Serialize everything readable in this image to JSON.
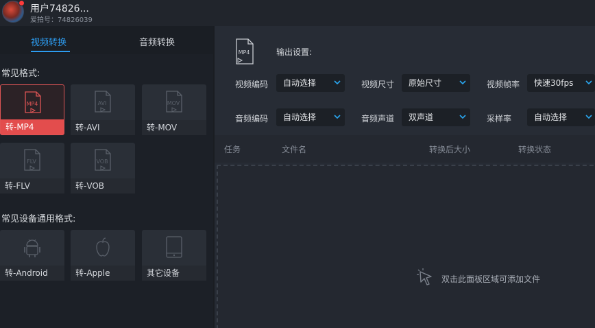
{
  "user": {
    "name": "用户74826...",
    "id_text": "爱拍号：74826039"
  },
  "tabs": {
    "video": "视频转换",
    "audio": "音频转换"
  },
  "sections": {
    "common_formats": "常见格式:",
    "device_formats": "常见设备通用格式:"
  },
  "formats": [
    {
      "icon_text": "MP4",
      "label": "转-MP4",
      "selected": true
    },
    {
      "icon_text": "AVI",
      "label": "转-AVI",
      "selected": false
    },
    {
      "icon_text": "MOV",
      "label": "转-MOV",
      "selected": false
    },
    {
      "icon_text": "FLV",
      "label": "转-FLV",
      "selected": false
    },
    {
      "icon_text": "VOB",
      "label": "转-VOB",
      "selected": false
    }
  ],
  "devices": [
    {
      "icon": "android-icon",
      "label": "转-Android"
    },
    {
      "icon": "apple-icon",
      "label": "转-Apple"
    },
    {
      "icon": "tablet-icon",
      "label": "其它设备"
    }
  ],
  "output": {
    "icon_text": "MP4",
    "label": "输出设置:",
    "video_codec_label": "视频编码",
    "video_codec_value": "自动选择",
    "video_size_label": "视频尺寸",
    "video_size_value": "原始尺寸",
    "video_fps_label": "视频帧率",
    "video_fps_value": "快速30fps",
    "audio_codec_label": "音频编码",
    "audio_codec_value": "自动选择",
    "audio_channel_label": "音频声道",
    "audio_channel_value": "双声道",
    "sample_rate_label": "采样率",
    "sample_rate_value": "自动选择"
  },
  "table": {
    "col_task": "任务",
    "col_filename": "文件名",
    "col_size": "转换后大小",
    "col_status": "转换状态"
  },
  "dropzone": {
    "hint": "双击此面板区域可添加文件"
  },
  "colors": {
    "accent": "#2d9cf0",
    "selected": "#e34d4d",
    "chevron": "#2aa8f2"
  }
}
